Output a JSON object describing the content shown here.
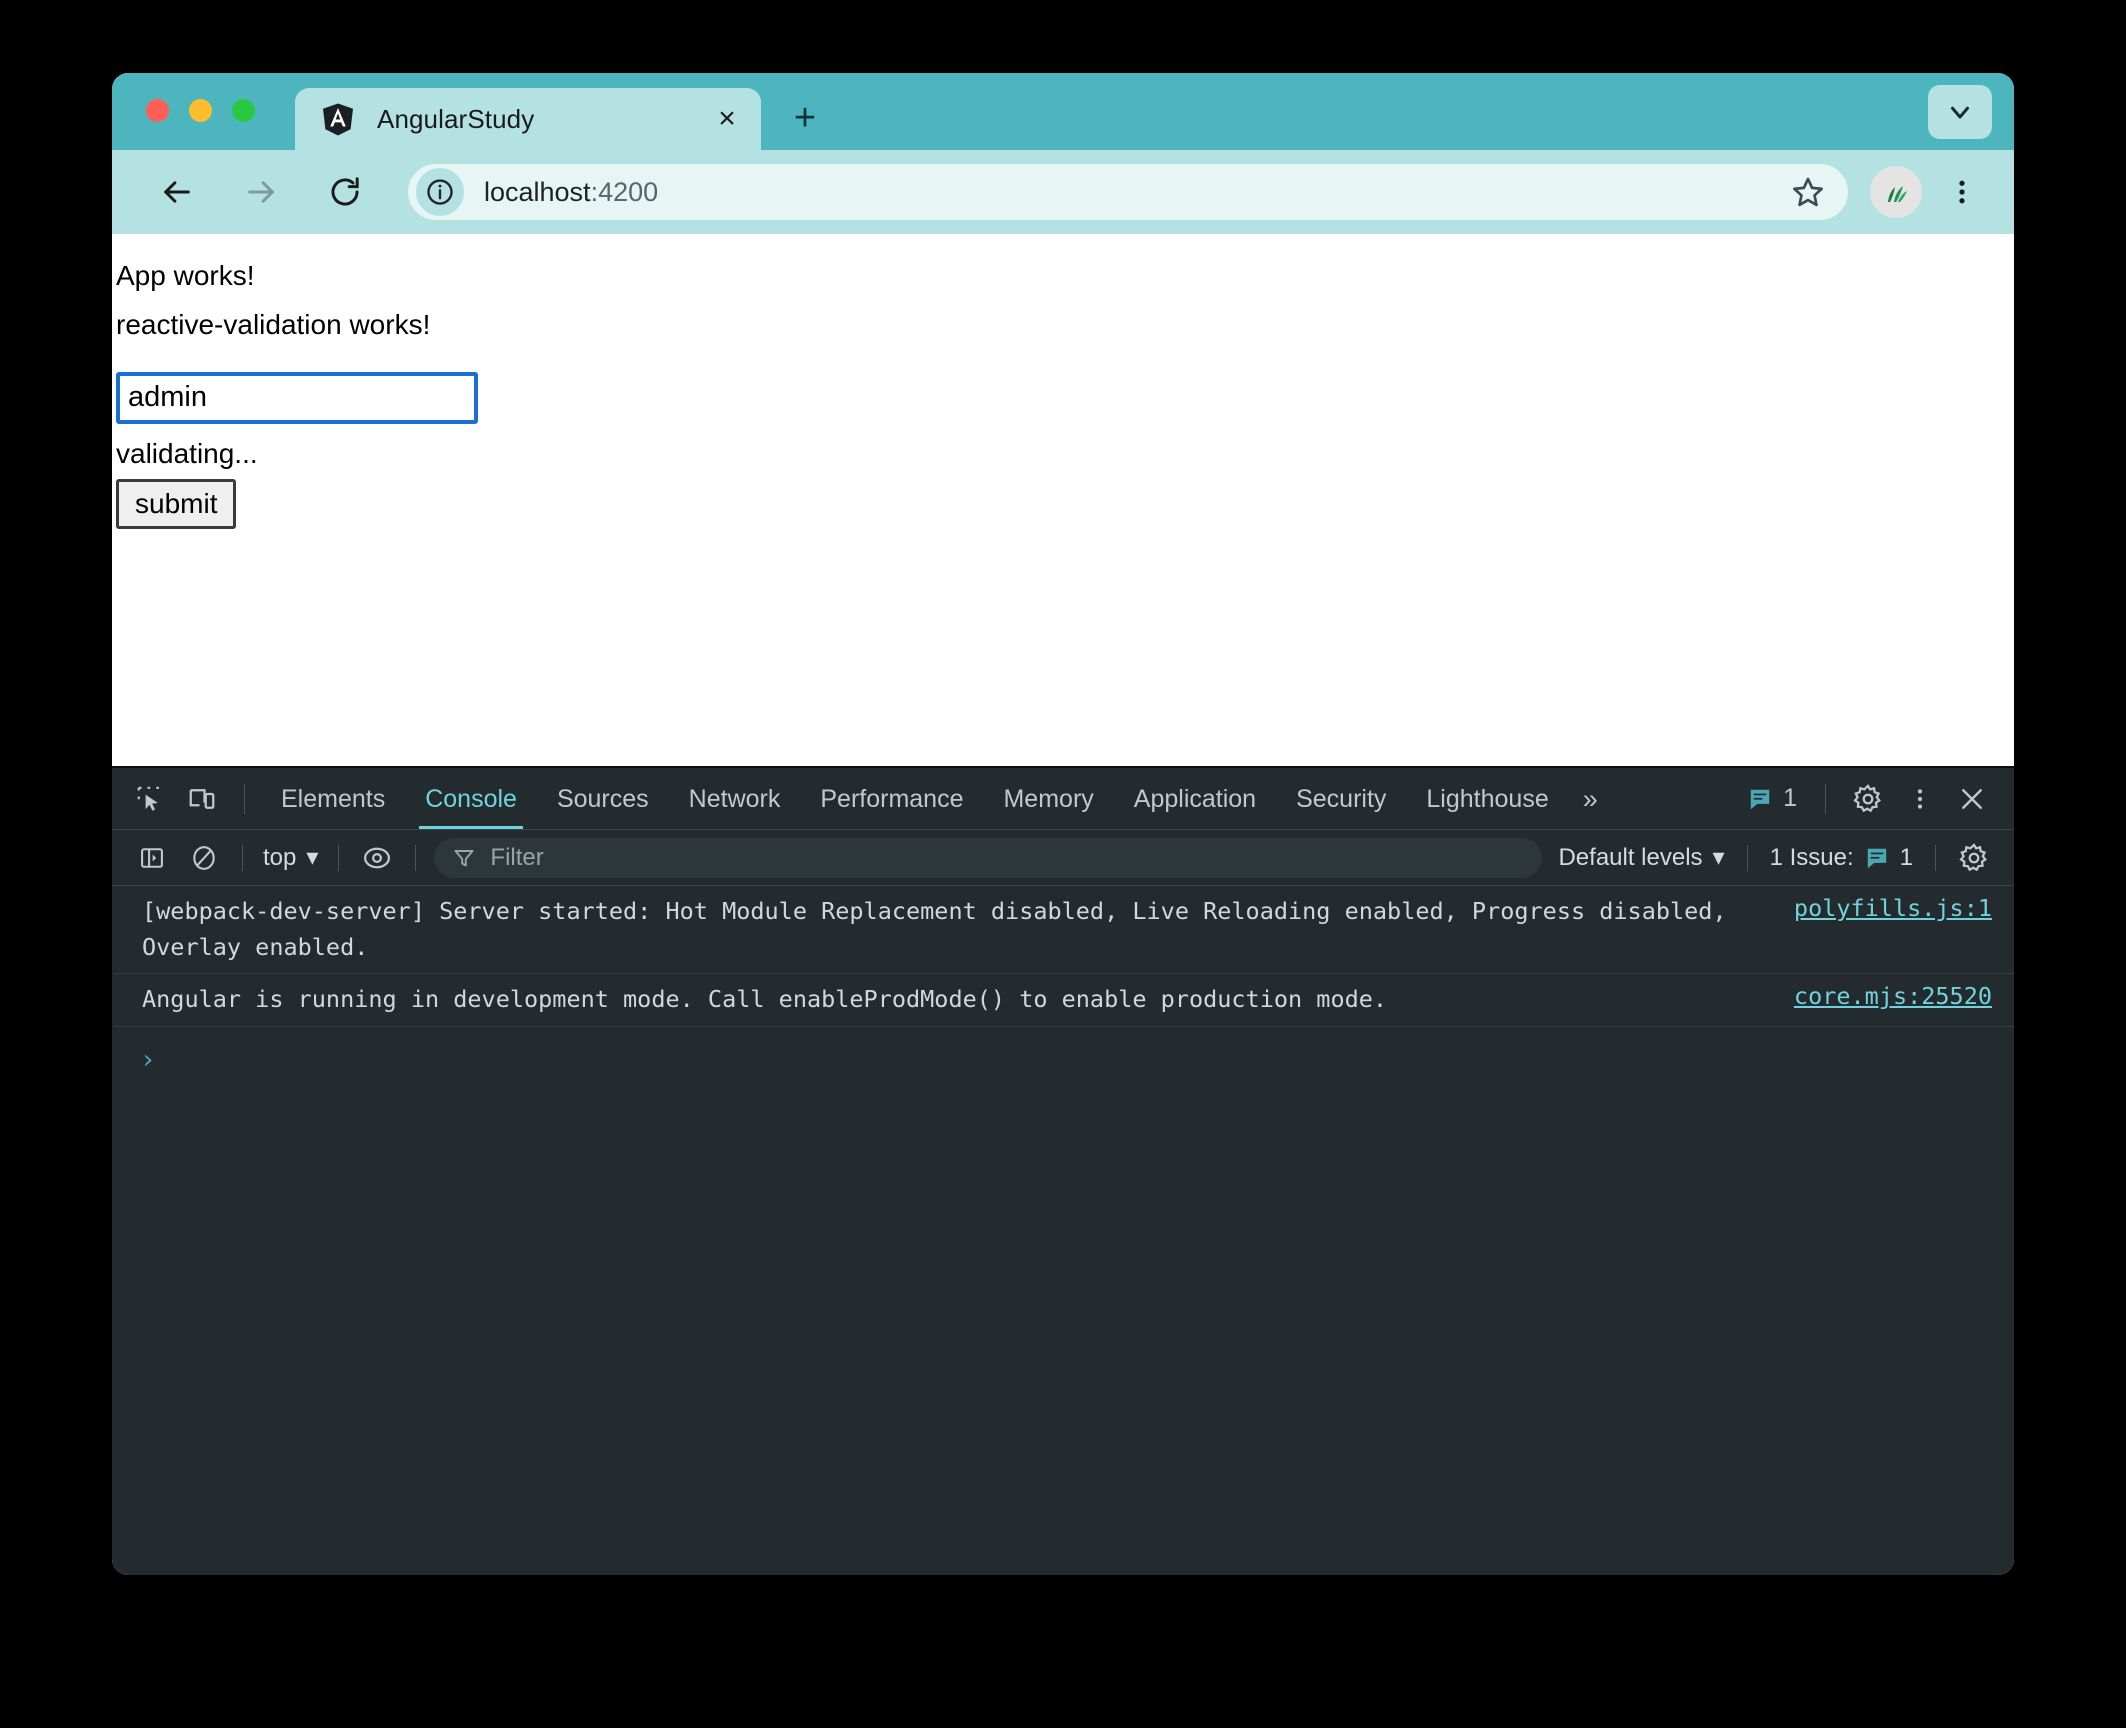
{
  "window": {
    "traffic_lights": [
      "close",
      "minimize",
      "maximize"
    ],
    "colors": {
      "titlebar": "#4cb5bd",
      "toolbar": "#b4e2e3",
      "omnibox": "#e6f6f5",
      "devtools_bg": "#242b2e",
      "devtools_accent": "#6fd3de",
      "input_focus_border": "#1a6fd4"
    }
  },
  "tabs": [
    {
      "title": "AngularStudy",
      "favicon": "angular-shield-icon",
      "active": true
    }
  ],
  "tabstrip": {
    "new_tab_label": "+",
    "close_label": "×",
    "expand_label": "chevron-down-icon"
  },
  "toolbar": {
    "back_label": "back-arrow-icon",
    "forward_label": "forward-arrow-icon",
    "reload_label": "reload-icon",
    "bookmark_label": "star-icon",
    "profile_label": "avatar",
    "menu_label": "kebab-menu-icon"
  },
  "omnibox": {
    "host": "localhost",
    "port": ":4200",
    "full_url": "localhost:4200",
    "site_info_icon": "info-circle-icon"
  },
  "page": {
    "heading_app": "App works!",
    "heading_component": "reactive-validation works!",
    "input_value": "admin",
    "input_placeholder": "",
    "status_text": "validating...",
    "submit_label": "submit"
  },
  "devtools": {
    "tabs": [
      {
        "label": "Elements",
        "active": false
      },
      {
        "label": "Console",
        "active": true
      },
      {
        "label": "Sources",
        "active": false
      },
      {
        "label": "Network",
        "active": false
      },
      {
        "label": "Performance",
        "active": false
      },
      {
        "label": "Memory",
        "active": false
      },
      {
        "label": "Application",
        "active": false
      },
      {
        "label": "Security",
        "active": false
      },
      {
        "label": "Lighthouse",
        "active": false
      }
    ],
    "more_tabs_label": "»",
    "issues_count": "1",
    "icons": {
      "inspect": "inspect-element-icon",
      "device": "device-toolbar-icon",
      "settings": "gear-icon",
      "more": "kebab-menu-icon",
      "close": "close-icon"
    },
    "console_toolbar": {
      "sidebar_label": "console-sidebar-icon",
      "clear_label": "clear-console-icon",
      "context": "top",
      "context_caret": "▾",
      "eye_label": "live-expression-icon",
      "filter_placeholder": "Filter",
      "filter_icon": "filter-icon",
      "levels": "Default levels",
      "levels_caret": "▾",
      "issues_text": "1 Issue:",
      "issues_count": "1",
      "settings_label": "gear-icon"
    },
    "console_messages": [
      {
        "text": "[webpack-dev-server] Server started: Hot Module Replacement disabled, Live Reloading enabled, Progress disabled, Overlay enabled.",
        "source": "polyfills.js:1"
      },
      {
        "text": "Angular is running in development mode. Call enableProdMode() to enable production mode.",
        "source": "core.mjs:25520"
      }
    ],
    "prompt_chevron": "›"
  }
}
